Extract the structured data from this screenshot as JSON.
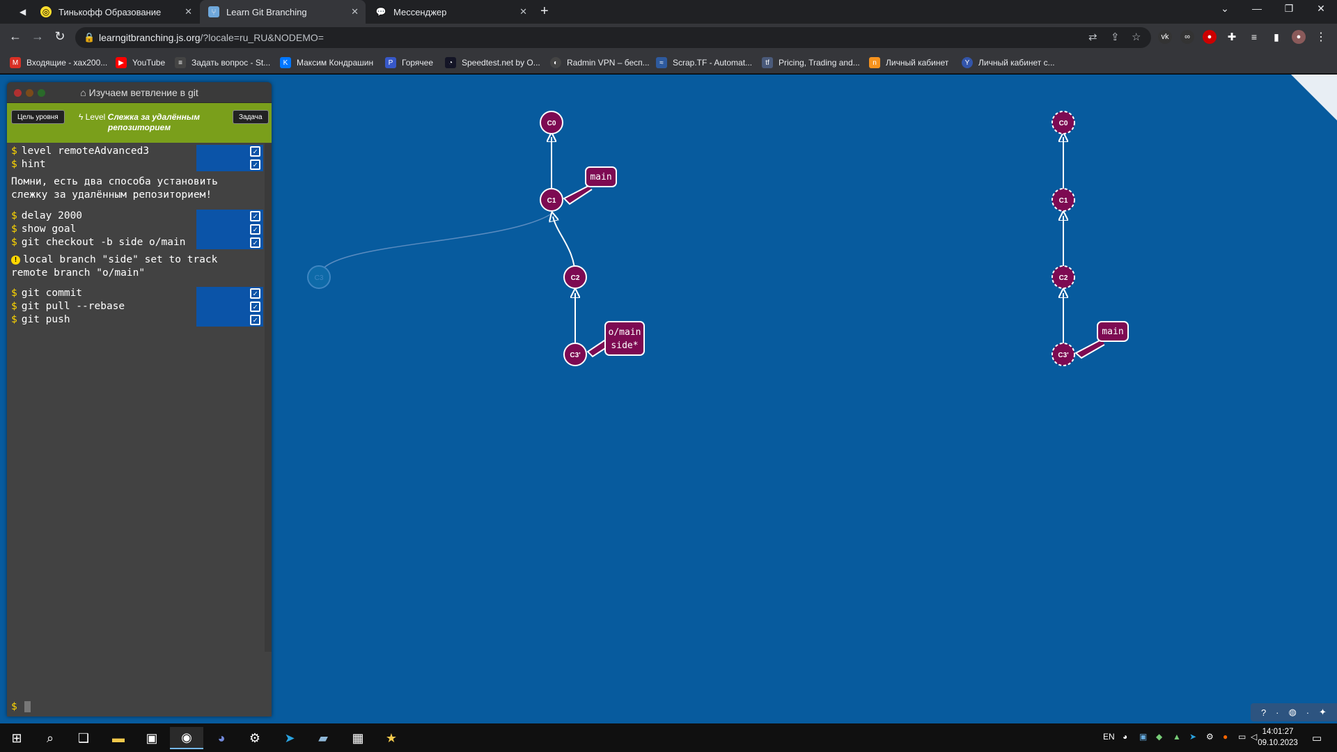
{
  "browser": {
    "tabs": [
      {
        "title": "Тинькофф Образование",
        "active": false
      },
      {
        "title": "Learn Git Branching",
        "active": true
      },
      {
        "title": "Мессенджер",
        "active": false
      }
    ],
    "url_host": "learngitbranching.js.org",
    "url_path": "/?locale=ru_RU&NODEMO=",
    "bookmarks": [
      {
        "label": "Входящие - xax200...",
        "icon": "gmail-icon",
        "color": "#d93025"
      },
      {
        "label": "YouTube",
        "icon": "youtube-icon",
        "color": "#ff0000"
      },
      {
        "label": "Задать вопрос - St...",
        "icon": "stackoverflow-icon",
        "color": "#444"
      },
      {
        "label": "Максим Кондрашин",
        "icon": "vk-icon",
        "color": "#0077ff"
      },
      {
        "label": "Горячее",
        "icon": "pikabu-icon",
        "color": "#3758c8"
      },
      {
        "label": "Speedtest.net by O...",
        "icon": "speedtest-icon",
        "color": "#141526"
      },
      {
        "label": "Radmin VPN – бесп...",
        "icon": "radmin-icon",
        "color": "#444"
      },
      {
        "label": "Scrap.TF - Automat...",
        "icon": "scraptf-icon",
        "color": "#2e5a9e"
      },
      {
        "label": "Pricing, Trading and...",
        "icon": "tf-icon",
        "color": "#4a5a7a"
      },
      {
        "label": "Личный кабинет",
        "icon": "cabinet-icon",
        "color": "#f7931e"
      },
      {
        "label": "Личный кабинет с...",
        "icon": "cabinet2-icon",
        "color": "#3355aa"
      }
    ]
  },
  "terminal": {
    "title": "Изучаем ветвление в git",
    "goal_button": "Цель уровня",
    "task_button": "Задача",
    "level_prefix": "Level",
    "level_name": "Слежка за удалённым репозиторием",
    "block1": [
      "level remoteAdvanced3",
      "hint"
    ],
    "hint_text": "Помни, есть два способа установить слежку за удалённым репозиторием!",
    "block2": [
      "delay 2000",
      "show goal",
      "git checkout -b side o/main"
    ],
    "info_text": "local branch \"side\" set to track remote branch \"o/main\"",
    "block3": [
      "git commit",
      "git pull --rebase",
      "git push"
    ],
    "prompt": "$"
  },
  "local_tree": {
    "commits": [
      "C0",
      "C1",
      "C2",
      "C3'"
    ],
    "ghost_commit": "C3",
    "branches": {
      "main": "main",
      "remote": "o/main",
      "side": "side*"
    }
  },
  "remote_tree": {
    "commits": [
      "C0",
      "C1",
      "C2",
      "C3'"
    ],
    "branches": {
      "main": "main"
    }
  },
  "colors": {
    "commit": "#7d0a52",
    "page_bg": "#075b9e",
    "level_bar": "#7a9f1b"
  },
  "taskbar": {
    "lang": "EN",
    "time": "14:01:27",
    "date": "09.10.2023"
  }
}
